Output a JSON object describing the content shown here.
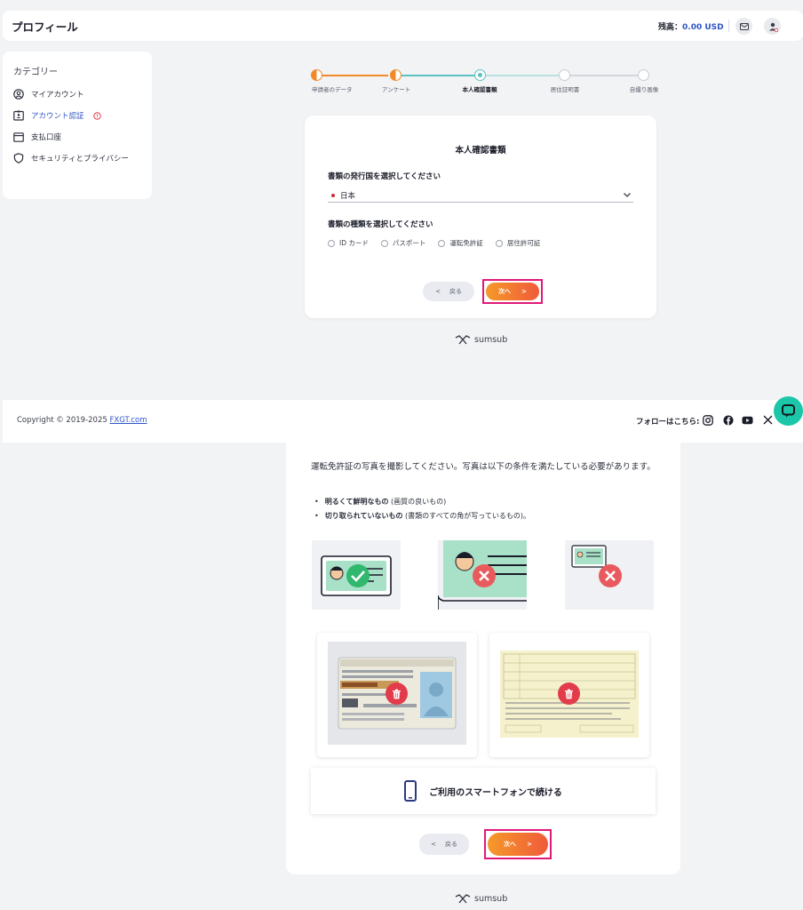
{
  "header": {
    "title": "プロフィール",
    "balance_label": "残高：",
    "balance_value": "0.00 USD"
  },
  "sidebar": {
    "category": "カテゴリー",
    "items": [
      {
        "label": "マイアカウント",
        "icon": "user-circle-icon"
      },
      {
        "label": "アカウント認証",
        "icon": "id-card-icon",
        "active": true
      },
      {
        "label": "支払口座",
        "icon": "wallet-icon"
      },
      {
        "label": "セキュリティとプライバシー",
        "icon": "shield-icon"
      }
    ]
  },
  "stepper": {
    "steps": [
      {
        "label": "申請者のデータ",
        "state": "partial"
      },
      {
        "label": "アンケート",
        "state": "partial"
      },
      {
        "label": "本人確認書類",
        "state": "current"
      },
      {
        "label": "居住証明書",
        "state": "todo"
      },
      {
        "label": "自撮り画像",
        "state": "todo"
      }
    ]
  },
  "id_card": {
    "title": "本人確認書類",
    "country_question": "書類の発行国を選択してください",
    "country_value": "日本",
    "type_question": "書類の種類を選択してください",
    "doc_types": [
      "ID カード",
      "パスポート",
      "運転免許証",
      "居住許可証"
    ],
    "back_label": "戻る",
    "next_label": "次へ"
  },
  "brand": "sumsub",
  "footer": {
    "copyright": "Copyright © 2019-2025 ",
    "copyright_link": "FXGT.com",
    "follow_label": "フォローはこちら:"
  },
  "upload": {
    "intro": "運転免許証の写真を撮影してください。写真は以下の条件を満たしている必要があります。",
    "rule1_bold": "明るくて鮮明なもの",
    "rule1_rest": " (画質の良いもの)",
    "rule2_bold": "切り取られていないもの",
    "rule2_rest": " (書類のすべての角が写っているもの)。",
    "phone_label": "ご利用のスマートフォンで続ける",
    "back_label": "戻る",
    "next_label": "次へ"
  },
  "colors": {
    "accent_blue": "#2f55c8",
    "accent_orange": "#f28a2a",
    "step_teal": "#5bc2c0",
    "highlight": "#e0187a",
    "chat_green": "#1bc7a8"
  }
}
